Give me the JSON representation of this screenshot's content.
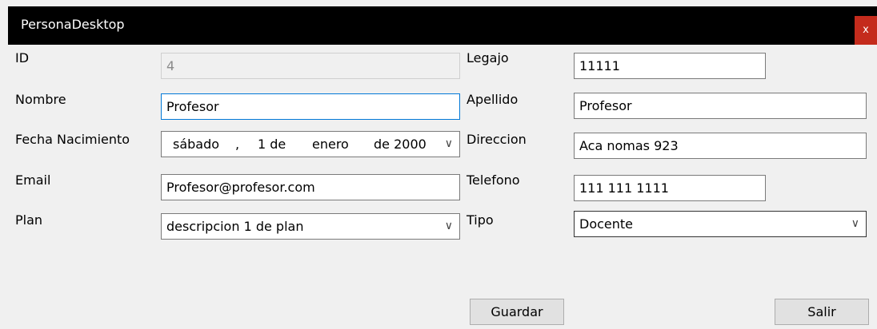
{
  "window": {
    "title": "PersonaDesktop",
    "close_label": "x"
  },
  "left_fields": {
    "id": {
      "label": "ID",
      "value": "4"
    },
    "nombre": {
      "label": "Nombre",
      "value": "Profesor"
    },
    "fecha": {
      "label": "Fecha Nacimiento",
      "weekday": "sábado",
      "sep": ",",
      "day": "1 de",
      "month": "enero",
      "year": "de 2000"
    },
    "email": {
      "label": "Email",
      "value": "Profesor@profesor.com"
    },
    "plan": {
      "label": "Plan",
      "value": "descripcion 1 de plan"
    }
  },
  "right_fields": {
    "legajo": {
      "label": "Legajo",
      "value": "11111"
    },
    "apellido": {
      "label": "Apellido",
      "value": "Profesor"
    },
    "direccion": {
      "label": "Direccion",
      "value": "Aca nomas 923"
    },
    "telefono": {
      "label": "Telefono",
      "value": "111 111 1111"
    },
    "tipo": {
      "label": "Tipo",
      "value": "Docente"
    }
  },
  "buttons": {
    "guardar": "Guardar",
    "salir": "Salir"
  },
  "icons": {
    "dropdown": "chevron-down-icon"
  }
}
